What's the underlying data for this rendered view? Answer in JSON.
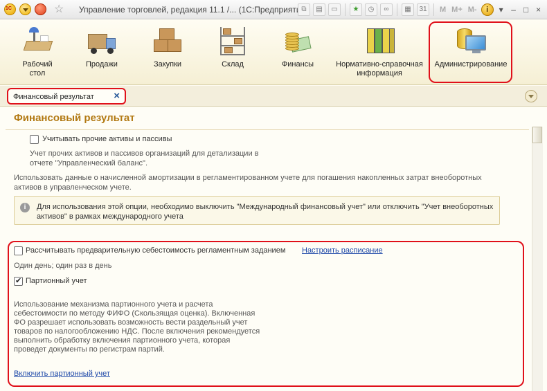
{
  "window": {
    "title": "Управление торговлей, редакция 11.1 /...  (1С:Предприятие)",
    "toolbar_m_labels": [
      "M",
      "M+",
      "M-"
    ]
  },
  "sections": [
    {
      "label": "Рабочий\nстол",
      "icon": "desk-icon"
    },
    {
      "label": "Продажи",
      "icon": "truck-icon"
    },
    {
      "label": "Закупки",
      "icon": "boxes-icon"
    },
    {
      "label": "Склад",
      "icon": "warehouse-shelf-icon"
    },
    {
      "label": "Финансы",
      "icon": "coins-icon"
    },
    {
      "label": "Нормативно-справочная\nинформация",
      "icon": "folders-icon"
    },
    {
      "label": "Администрирование",
      "icon": "database-monitor-icon"
    }
  ],
  "tab": {
    "label": "Финансовый результат"
  },
  "page": {
    "title": "Финансовый результат",
    "other_assets": {
      "checkbox_label": "Учитывать прочие активы и пассивы",
      "checked": false,
      "hint_line1": "Учет прочих активов и пассивов организаций для детализации в",
      "hint_line2": "отчете \"Управленческий баланс\"."
    },
    "amortization": {
      "line1": "Использовать данные о начисленной амортизации в регламентированном учете для погашения накопленных затрат внеоборотных",
      "line2": "активов в управленческом учете."
    },
    "note": {
      "line1": "Для использования этой опции, необходимо выключить \"Международный финансовый учет\" или отключить \"Учет внеоборотных",
      "line2": "активов\" в рамках международного учета"
    },
    "cost_calc": {
      "checkbox_label": "Рассчитывать предварительную себестоимость регламентным заданием",
      "checked": false,
      "schedule_link": "Настроить расписание",
      "schedule_text": "Один день; один раз в день"
    },
    "batch": {
      "checkbox_label": "Партионный учет",
      "checked": true,
      "desc_lines": [
        "Использование механизма партионного учета и расчета",
        "себестоимости по методу ФИФО (Скользящая оценка). Включенная",
        "ФО разрешает использовать возможность вести раздельный учет",
        "товаров по налогообложению НДС. После  включения рекомендуется",
        "выполнить обработку включения партионного учета, которая",
        "проведет документы по регистрам партий."
      ],
      "enable_link": "Включить партионный учет"
    }
  },
  "colors": {
    "title": "#b27912",
    "highlight": "#e0101a",
    "link": "#1c47a8"
  }
}
